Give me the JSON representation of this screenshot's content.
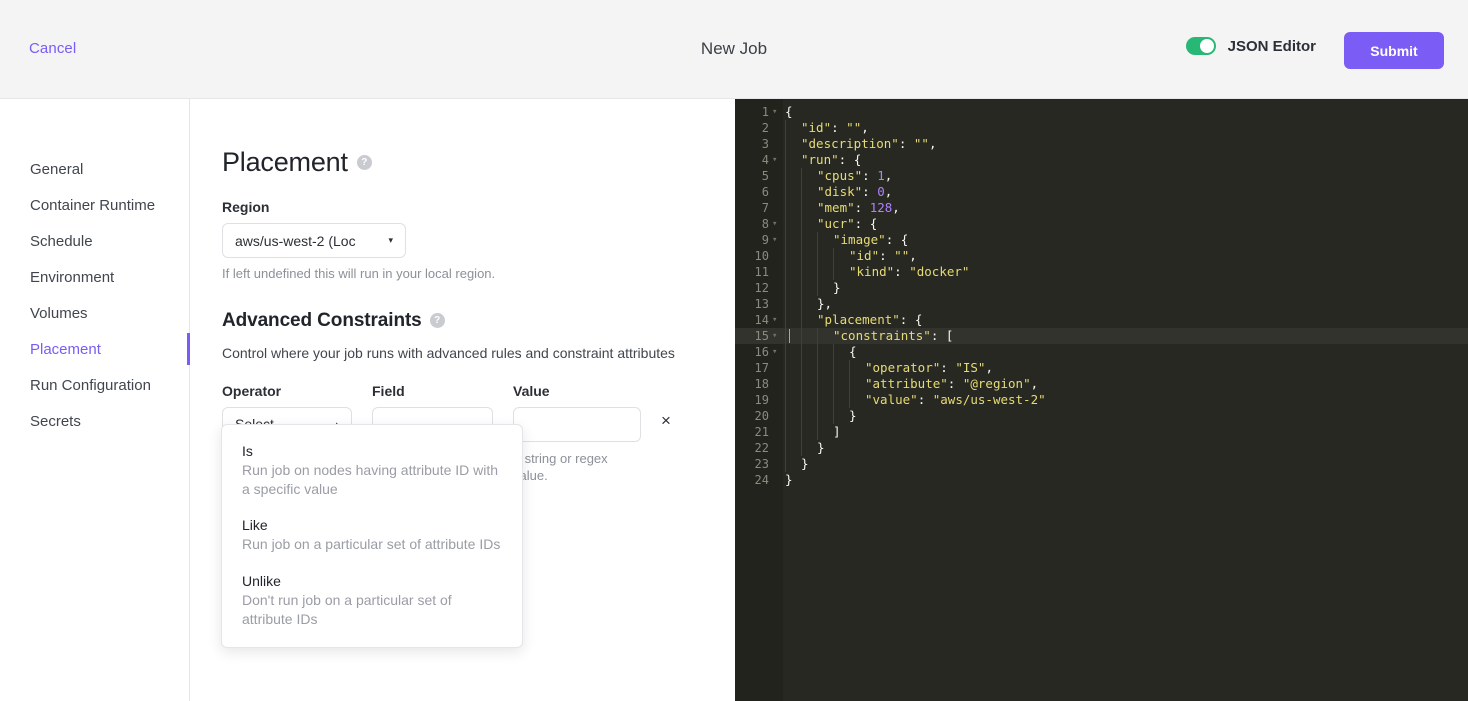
{
  "header": {
    "cancel_label": "Cancel",
    "title": "New Job",
    "toggle_label": "JSON Editor",
    "toggle_state": "on",
    "submit_label": "Submit",
    "accent_color": "#7b5cf5",
    "toggle_on_color": "#28b876"
  },
  "sidebar": {
    "items": [
      {
        "label": "General",
        "active": false
      },
      {
        "label": "Container Runtime",
        "active": false
      },
      {
        "label": "Schedule",
        "active": false
      },
      {
        "label": "Environment",
        "active": false
      },
      {
        "label": "Volumes",
        "active": false
      },
      {
        "label": "Placement",
        "active": true
      },
      {
        "label": "Run Configuration",
        "active": false
      },
      {
        "label": "Secrets",
        "active": false
      }
    ]
  },
  "form": {
    "placement_heading": "Placement",
    "help_glyph": "?",
    "region_label": "Region",
    "region_value": "aws/us-west-2 (Loc",
    "region_caret": "▾",
    "region_hint": "If left undefined this will run in your local region.",
    "constraints_heading": "Advanced Constraints",
    "constraints_description": "Control where your job runs with advanced rules and constraint attributes",
    "operator_label": "Operator",
    "operator_value": "Select ...",
    "operator_caret": "▴",
    "field_label": "Field",
    "field_value": "",
    "field_placeholder": "",
    "value_label": "Value",
    "value_value": "",
    "value_placeholder": "",
    "value_hint": "A string or regex value.",
    "remove_glyph": "×"
  },
  "dropdown": {
    "options": [
      {
        "title": "Is",
        "desc": "Run job on nodes having attribute ID with a specific value"
      },
      {
        "title": "Like",
        "desc": "Run job on a particular set of attribute IDs"
      },
      {
        "title": "Unlike",
        "desc": "Don't run job on a particular set of attribute IDs"
      }
    ]
  },
  "editor": {
    "active_line": 15,
    "background": "#272822",
    "lines": [
      {
        "num": 1,
        "fold": true,
        "indent": 0,
        "html": "<span class=\"p\">{</span>"
      },
      {
        "num": 2,
        "fold": false,
        "indent": 1,
        "html": "<span class=\"s\">\"id\"</span><span class=\"p\">: </span><span class=\"s\">\"\"</span><span class=\"p\">,</span>"
      },
      {
        "num": 3,
        "fold": false,
        "indent": 1,
        "html": "<span class=\"s\">\"description\"</span><span class=\"p\">: </span><span class=\"s\">\"\"</span><span class=\"p\">,</span>"
      },
      {
        "num": 4,
        "fold": true,
        "indent": 1,
        "html": "<span class=\"s\">\"run\"</span><span class=\"p\">: {</span>"
      },
      {
        "num": 5,
        "fold": false,
        "indent": 2,
        "html": "<span class=\"s\">\"cpus\"</span><span class=\"p\">: </span><span class=\"n\">1</span><span class=\"p\">,</span>"
      },
      {
        "num": 6,
        "fold": false,
        "indent": 2,
        "html": "<span class=\"s\">\"disk\"</span><span class=\"p\">: </span><span class=\"n\">0</span><span class=\"p\">,</span>"
      },
      {
        "num": 7,
        "fold": false,
        "indent": 2,
        "html": "<span class=\"s\">\"mem\"</span><span class=\"p\">: </span><span class=\"n\">128</span><span class=\"p\">,</span>"
      },
      {
        "num": 8,
        "fold": true,
        "indent": 2,
        "html": "<span class=\"s\">\"ucr\"</span><span class=\"p\">: {</span>"
      },
      {
        "num": 9,
        "fold": true,
        "indent": 3,
        "html": "<span class=\"s\">\"image\"</span><span class=\"p\">: {</span>"
      },
      {
        "num": 10,
        "fold": false,
        "indent": 4,
        "html": "<span class=\"s\">\"id\"</span><span class=\"p\">: </span><span class=\"s\">\"\"</span><span class=\"p\">,</span>"
      },
      {
        "num": 11,
        "fold": false,
        "indent": 4,
        "html": "<span class=\"s\">\"kind\"</span><span class=\"p\">: </span><span class=\"s\">\"docker\"</span>"
      },
      {
        "num": 12,
        "fold": false,
        "indent": 3,
        "html": "<span class=\"p\">}</span>"
      },
      {
        "num": 13,
        "fold": false,
        "indent": 2,
        "html": "<span class=\"p\">},</span>"
      },
      {
        "num": 14,
        "fold": true,
        "indent": 2,
        "html": "<span class=\"s\">\"placement\"</span><span class=\"p\">: {</span>"
      },
      {
        "num": 15,
        "fold": true,
        "indent": 3,
        "html": "<span class=\"s\">\"constraints\"</span><span class=\"p\">: [</span>"
      },
      {
        "num": 16,
        "fold": true,
        "indent": 4,
        "html": "<span class=\"p\">{</span>"
      },
      {
        "num": 17,
        "fold": false,
        "indent": 5,
        "html": "<span class=\"s\">\"operator\"</span><span class=\"p\">: </span><span class=\"s\">\"IS\"</span><span class=\"p\">,</span>"
      },
      {
        "num": 18,
        "fold": false,
        "indent": 5,
        "html": "<span class=\"s\">\"attribute\"</span><span class=\"p\">: </span><span class=\"s\">\"@region\"</span><span class=\"p\">,</span>"
      },
      {
        "num": 19,
        "fold": false,
        "indent": 5,
        "html": "<span class=\"s\">\"value\"</span><span class=\"p\">: </span><span class=\"s\">\"aws/us-west-2\"</span>"
      },
      {
        "num": 20,
        "fold": false,
        "indent": 4,
        "html": "<span class=\"p\">}</span>"
      },
      {
        "num": 21,
        "fold": false,
        "indent": 3,
        "html": "<span class=\"p\">]</span>"
      },
      {
        "num": 22,
        "fold": false,
        "indent": 2,
        "html": "<span class=\"p\">}</span>"
      },
      {
        "num": 23,
        "fold": false,
        "indent": 1,
        "html": "<span class=\"p\">}</span>"
      },
      {
        "num": 24,
        "fold": false,
        "indent": 0,
        "html": "<span class=\"p\">}</span>"
      }
    ],
    "plain_text": "{\n  \"id\": \"\",\n  \"description\": \"\",\n  \"run\": {\n    \"cpus\": 1,\n    \"disk\": 0,\n    \"mem\": 128,\n    \"ucr\": {\n      \"image\": {\n        \"id\": \"\",\n        \"kind\": \"docker\"\n      }\n    },\n    \"placement\": {\n      \"constraints\": [\n        {\n          \"operator\": \"IS\",\n          \"attribute\": \"@region\",\n          \"value\": \"aws/us-west-2\"\n        }\n      ]\n    }\n  }\n}"
  }
}
